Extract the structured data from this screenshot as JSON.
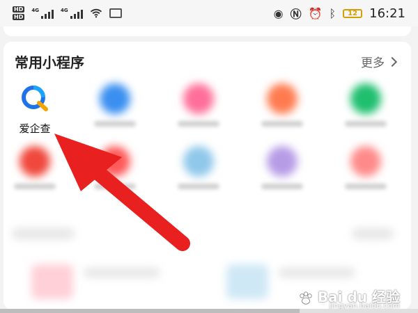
{
  "status_bar": {
    "network_tags": [
      "HD",
      "HD"
    ],
    "signal1_tag": "4G",
    "signal2_tag": "4G",
    "battery": "12",
    "time": "16:21"
  },
  "section": {
    "title": "常用小程序",
    "more_label": "更多"
  },
  "apps": [
    {
      "label": "爱企查",
      "icon": "aiqicha-icon",
      "color": "#1e73e8"
    },
    {
      "label": "",
      "icon": "blurred-app-icon",
      "color": "#3a8ff0"
    },
    {
      "label": "",
      "icon": "blurred-app-icon",
      "color": "#ff6f9a"
    },
    {
      "label": "",
      "icon": "blurred-app-icon",
      "color": "#ff7b4f"
    },
    {
      "label": "",
      "icon": "blurred-app-icon",
      "color": "#1fbf6f"
    },
    {
      "label": "",
      "icon": "blurred-app-icon",
      "color": "#f0483c"
    },
    {
      "label": "",
      "icon": "blurred-app-icon",
      "color": "#ff5a5a"
    },
    {
      "label": "",
      "icon": "blurred-app-icon",
      "color": "#8fc8ea"
    },
    {
      "label": "",
      "icon": "blurred-app-icon",
      "color": "#b69ce6"
    },
    {
      "label": "",
      "icon": "blurred-app-icon",
      "color": "#ff8a8a"
    }
  ],
  "annotation": {
    "arrow_color": "#e8201f"
  },
  "watermark": {
    "text": "Bai du 经验",
    "sub": "jingyan.baidu.com"
  }
}
